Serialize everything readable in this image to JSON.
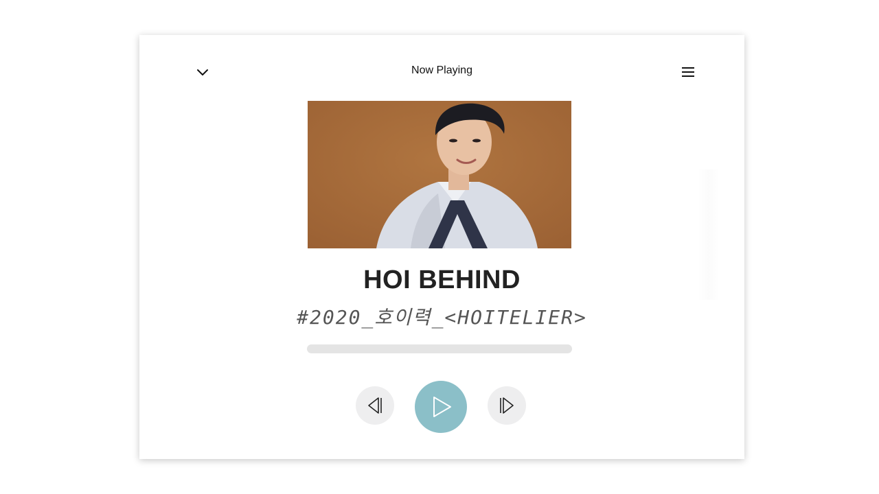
{
  "header": {
    "title": "Now Playing",
    "collapse_icon": "chevron-down-icon",
    "menu_icon": "hamburger-menu-icon"
  },
  "track": {
    "title": "HOI BEHIND",
    "subtitle": "#2020_호이력_<HOITELIER>",
    "artwork_icon": "album-artwork"
  },
  "progress": {
    "value": 0
  },
  "controls": {
    "prev_icon": "skip-previous-icon",
    "play_icon": "play-icon",
    "next_icon": "skip-next-icon"
  },
  "colors": {
    "accent": "#8bbfc8",
    "control_bg": "#eeeeef",
    "track_bg": "#e4e4e4",
    "artwork_bg": "#a46a3d"
  }
}
